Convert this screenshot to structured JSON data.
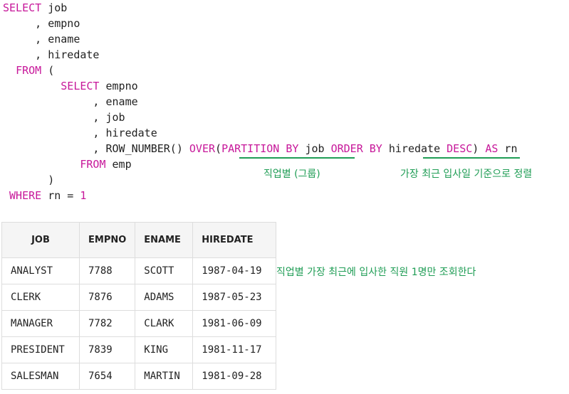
{
  "code": {
    "line1": {
      "kw": "SELECT",
      "rest": " job"
    },
    "line2": "     , empno",
    "line3": "     , ename",
    "line4": "     , hiredate",
    "line5": {
      "indent": "  ",
      "kw": "FROM",
      "rest": " ("
    },
    "line6": {
      "indent": "         ",
      "kw": "SELECT",
      "rest": " empno"
    },
    "line7": "              , ename",
    "line8": "              , job",
    "line9": "              , hiredate",
    "line10": {
      "indent": "              , ",
      "fn": "ROW_NUMBER() ",
      "over": "OVER",
      "paren_open": "(",
      "partition": "PARTITION BY",
      "sp1": " ",
      "col1": "job",
      "sp2": " ",
      "order": "ORDER BY",
      "sp3": " ",
      "col2": "hiredate",
      "sp4": " ",
      "desc": "DESC",
      "paren_close": ")",
      "sp5": " ",
      "as": "AS",
      "alias": " rn"
    },
    "line11": {
      "indent": "            ",
      "kw": "FROM",
      "rest": " emp"
    },
    "line12": "       )",
    "line13": {
      "indent": " ",
      "kw": "WHERE",
      "mid": " rn = ",
      "num": "1"
    }
  },
  "annotations": {
    "partition_note": "직업별 (그룹)",
    "order_note": "가장 최근 입사일 기준으로 정렬",
    "row_note": "직업별 가장 최근에 입사한 직원 1명만 조회한다"
  },
  "table": {
    "headers": [
      "JOB",
      "EMPNO",
      "ENAME",
      "HIREDATE"
    ],
    "rows": [
      [
        "ANALYST",
        "7788",
        "SCOTT",
        "1987-04-19"
      ],
      [
        "CLERK",
        "7876",
        "ADAMS",
        "1987-05-23"
      ],
      [
        "MANAGER",
        "7782",
        "CLARK",
        "1981-06-09"
      ],
      [
        "PRESIDENT",
        "7839",
        "KING",
        "1981-11-17"
      ],
      [
        "SALESMAN",
        "7654",
        "MARTIN",
        "1981-09-28"
      ]
    ]
  },
  "colors": {
    "keyword": "#c7189a",
    "annotation": "#1f9d55",
    "text": "#222222"
  }
}
